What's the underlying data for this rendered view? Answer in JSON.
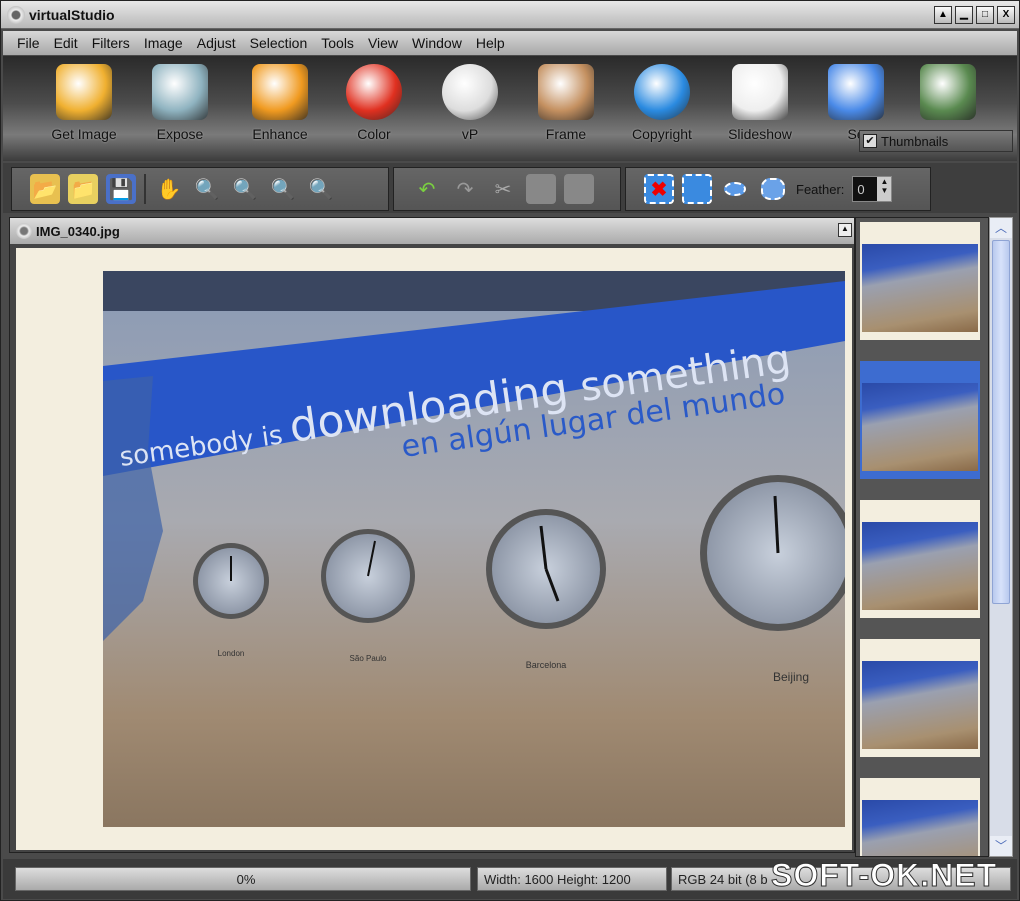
{
  "window": {
    "title": "virtualStudio",
    "buttons": [
      "▲",
      "▁",
      "□",
      "X"
    ]
  },
  "menu": [
    "File",
    "Edit",
    "Filters",
    "Image",
    "Adjust",
    "Selection",
    "Tools",
    "View",
    "Window",
    "Help"
  ],
  "big_toolbar": [
    {
      "label": "Get Image",
      "icon": "folder-photo-icon",
      "color": "#f0b030"
    },
    {
      "label": "Expose",
      "icon": "landscape-icon",
      "color": "#8fb3c0"
    },
    {
      "label": "Enhance",
      "icon": "enhance-arrow-icon",
      "color": "#f09a20"
    },
    {
      "label": "Color",
      "icon": "balloon-icon",
      "color": "#e03020"
    },
    {
      "label": "vP",
      "icon": "vp-ring-icon",
      "color": "#dddddd"
    },
    {
      "label": "Frame",
      "icon": "frame-icon",
      "color": "#c49060"
    },
    {
      "label": "Copyright",
      "icon": "copyright-icon",
      "color": "#2a8ae0"
    },
    {
      "label": "Slideshow",
      "icon": "slideshow-icon",
      "color": "#eeeeee"
    },
    {
      "label": "Se",
      "icon": "search-binoculars-icon",
      "color": "#4a8ae8"
    },
    {
      "label": "",
      "icon": "printer-icon",
      "color": "#5a8a50"
    }
  ],
  "thumbnails_toggle": {
    "label": "Thumbnails",
    "checked": true
  },
  "toolbar": {
    "file_tools": [
      "open-icon",
      "open-folder-icon",
      "save-icon"
    ],
    "view_tools": [
      "hand-icon",
      "zoom-1-icon",
      "zoom-fit-icon",
      "zoom-out-icon",
      "zoom-in-icon"
    ],
    "edit_tools": [
      "undo-icon",
      "redo-icon",
      "cut-icon",
      "copy-icon",
      "paste-icon"
    ],
    "select_tools": [
      "deselect-icon",
      "rect-select-icon",
      "ellipse-select-icon",
      "lasso-select-icon"
    ],
    "feather_label": "Feather:",
    "feather_value": "0"
  },
  "document": {
    "title": "IMG_0340.jpg",
    "photo_text": {
      "line1a": "somebody is ",
      "line1b": "downloading",
      "line1c": " something",
      "line2": "en algún lugar del mundo"
    },
    "clock_labels": [
      "London",
      "São Paulo",
      "Barcelona",
      "Beijing"
    ]
  },
  "thumbnails": [
    {
      "selected": false
    },
    {
      "selected": true
    },
    {
      "selected": false
    },
    {
      "selected": false
    },
    {
      "selected": false
    }
  ],
  "status": {
    "progress": "0%",
    "progress_value": 0,
    "dimensions": "Width: 1600  Height: 1200",
    "color_mode": "RGB 24 bit (8 b"
  },
  "watermark": "SOFT-OK.NET"
}
